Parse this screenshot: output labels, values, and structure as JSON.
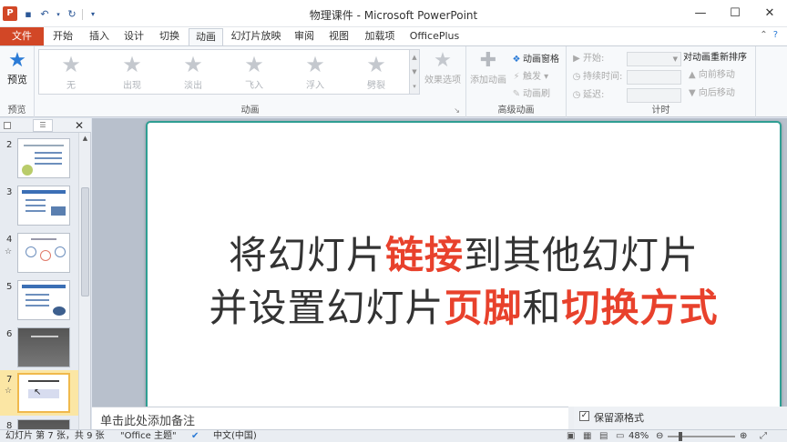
{
  "window": {
    "title": "物理课件 - Microsoft PowerPoint",
    "app_icon": "P",
    "minimize": "—",
    "maximize": "☐",
    "close": "✕"
  },
  "tabs": [
    {
      "label": "文件"
    },
    {
      "label": "开始"
    },
    {
      "label": "插入"
    },
    {
      "label": "设计"
    },
    {
      "label": "切换"
    },
    {
      "label": "动画"
    },
    {
      "label": "幻灯片放映"
    },
    {
      "label": "审阅"
    },
    {
      "label": "视图"
    },
    {
      "label": "加载项"
    },
    {
      "label": "OfficePlus"
    }
  ],
  "ribbon": {
    "preview_group": {
      "button": "预览",
      "label": "预览"
    },
    "animation_group": {
      "label": "动画",
      "items": [
        {
          "label": "无"
        },
        {
          "label": "出现"
        },
        {
          "label": "淡出"
        },
        {
          "label": "飞入"
        },
        {
          "label": "浮入"
        },
        {
          "label": "劈裂"
        }
      ],
      "effect_options": "效果选项"
    },
    "advanced_group": {
      "label": "高级动画",
      "add_animation": "添加动画",
      "pane": "动画窗格",
      "trigger": "触发",
      "painter": "动画刷"
    },
    "timing_group": {
      "label": "计时",
      "start": "开始:",
      "duration": "持续时间:",
      "delay": "延迟:",
      "reorder_title": "对动画重新排序",
      "move_earlier": "向前移动",
      "move_later": "向后移动"
    }
  },
  "slides_panel": {
    "thumbnails": [
      {
        "num": "2"
      },
      {
        "num": "3"
      },
      {
        "num": "4"
      },
      {
        "num": "5"
      },
      {
        "num": "6"
      },
      {
        "num": "7"
      },
      {
        "num": "8"
      }
    ]
  },
  "slide": {
    "line1_a": "将幻灯片",
    "line1_b": "链接",
    "line1_c": "到其他幻灯片",
    "line2_a": "并设置幻灯片",
    "line2_b": "页脚",
    "line2_c": "和",
    "line2_d": "切换方式"
  },
  "notes": {
    "placeholder": "单击此处添加备注"
  },
  "keep_format": {
    "label": "保留源格式",
    "checked": "✓"
  },
  "status": {
    "slide_info": "幻灯片 第 7 张，共 9 张",
    "theme": "\"Office 主题\"",
    "language": "中文(中国)",
    "zoom": "48%"
  },
  "colors": {
    "accent": "#d24726",
    "highlight_text": "#e8412c",
    "slide_border": "#2f9e93"
  }
}
